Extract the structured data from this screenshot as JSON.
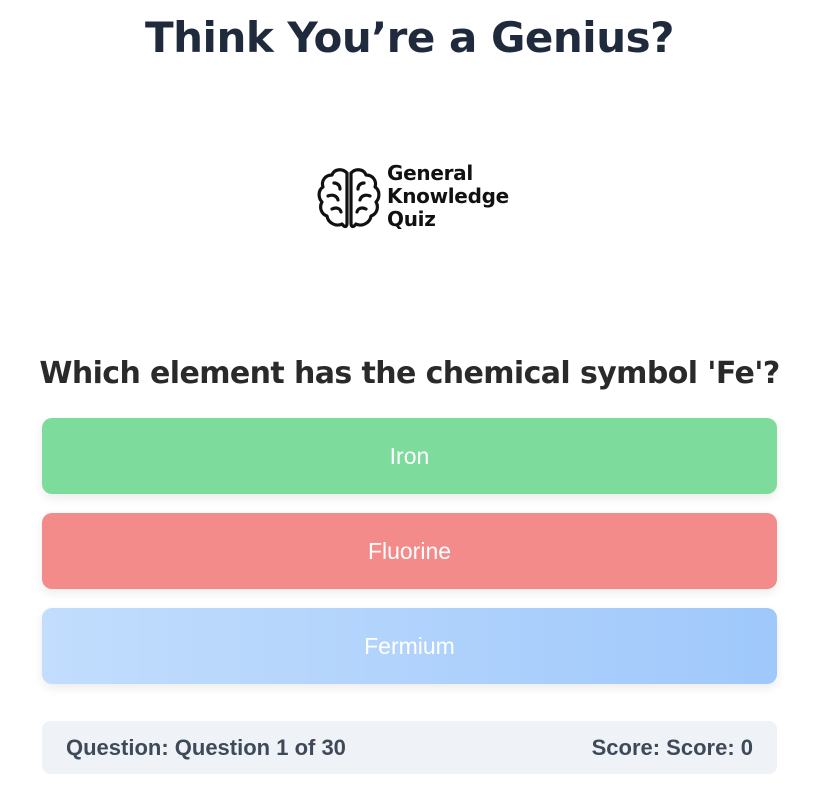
{
  "header": {
    "title": "Think You’re a Genius?"
  },
  "logo": {
    "icon": "brain-icon",
    "line1": "General",
    "line2": "Knowledge",
    "line3": "Quiz"
  },
  "quiz": {
    "question": "Which element has the chemical symbol 'Fe'?",
    "answers": [
      {
        "label": "Iron",
        "state": "correct",
        "color": "#7ddb9c"
      },
      {
        "label": "Fluorine",
        "state": "incorrect",
        "color": "#f48b8b"
      },
      {
        "label": "Fermium",
        "state": "neutral",
        "color": "#aecffc"
      }
    ]
  },
  "status": {
    "question_text": "Question: Question 1 of 30",
    "score_text": "Score: Score: 0"
  }
}
